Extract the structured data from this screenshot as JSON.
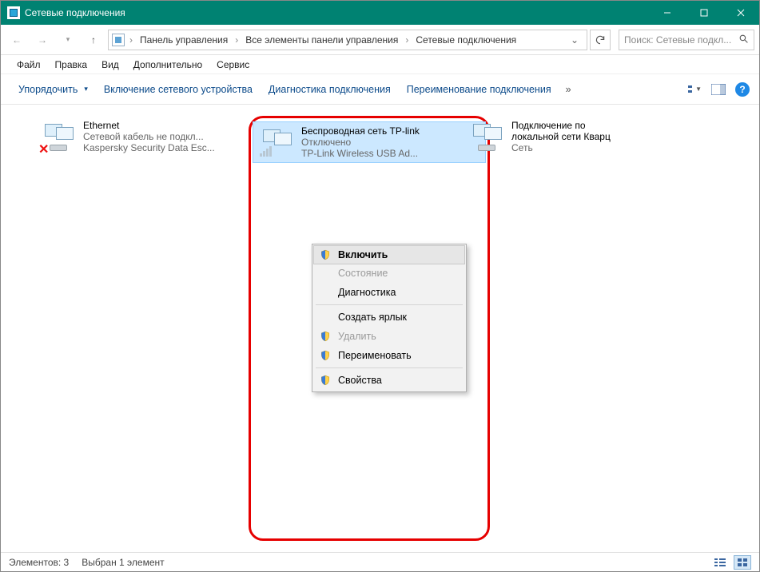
{
  "window": {
    "title": "Сетевые подключения"
  },
  "breadcrumb": {
    "root": "Панель управления",
    "mid": "Все элементы панели управления",
    "leaf": "Сетевые подключения"
  },
  "search": {
    "placeholder": "Поиск: Сетевые подкл..."
  },
  "menu": {
    "file": "Файл",
    "edit": "Правка",
    "view": "Вид",
    "advanced": "Дополнительно",
    "service": "Сервис"
  },
  "cmd": {
    "organize": "Упорядочить",
    "enable_device": "Включение сетевого устройства",
    "diagnose": "Диагностика подключения",
    "rename": "Переименование подключения"
  },
  "connections": [
    {
      "name": "Ethernet",
      "l2": "Сетевой кабель не подкл...",
      "l3": "Kaspersky Security Data Esc..."
    },
    {
      "name": "Беспроводная сеть TP-link",
      "l2": "Отключено",
      "l3": "TP-Link Wireless USB Ad..."
    },
    {
      "name_a": "Подключение по",
      "name_b": "локальной сети Кварц",
      "l2": "Сеть"
    }
  ],
  "ctx": {
    "enable": "Включить",
    "status": "Состояние",
    "diag": "Диагностика",
    "shortcut": "Создать ярлык",
    "delete": "Удалить",
    "rename": "Переименовать",
    "props": "Свойства"
  },
  "status": {
    "count": "Элементов: 3",
    "selected": "Выбран 1 элемент"
  }
}
